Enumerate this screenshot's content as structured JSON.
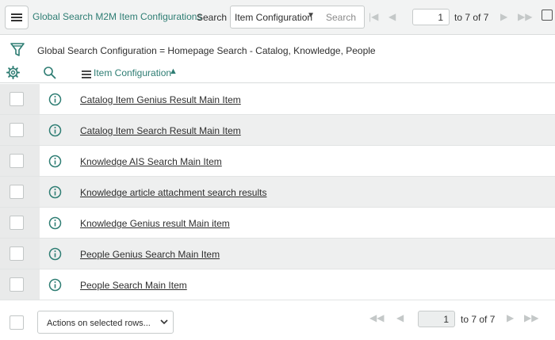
{
  "header": {
    "title": "Global Search M2M Item Configurations",
    "search_label": "Search",
    "search_field": "Item Configuration",
    "search_placeholder": "Search",
    "page_value": "1",
    "page_of": "to 7 of 7"
  },
  "filter": {
    "breadcrumb": "Global Search Configuration = Homepage Search - Catalog, Knowledge, People"
  },
  "columns": {
    "item_configuration": "Item Configuration",
    "sort_direction": "ascending"
  },
  "rows": [
    {
      "label": "Catalog Item Genius Result Main Item"
    },
    {
      "label": "Catalog Item Search Result Main Item"
    },
    {
      "label": "Knowledge AIS Search Main Item"
    },
    {
      "label": "Knowledge article attachment search results"
    },
    {
      "label": "Knowledge Genius result Main item"
    },
    {
      "label": "People Genius Search Main Item"
    },
    {
      "label": "People Search Main Item"
    }
  ],
  "footer": {
    "actions_label": "Actions on selected rows...",
    "page_value": "1",
    "page_of": "to 7 of 7"
  },
  "colors": {
    "accent": "#2e7d73",
    "header_bg": "#f2f3f3",
    "row_alt_bg": "#eeefef"
  }
}
